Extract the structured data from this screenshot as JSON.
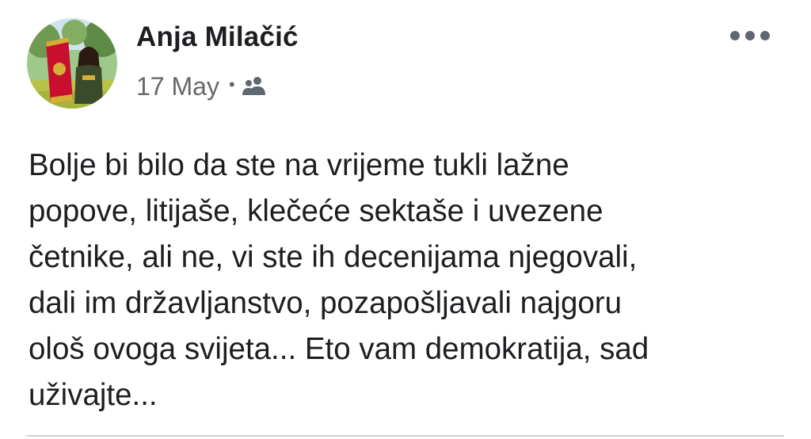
{
  "post": {
    "author": "Anja Milačić",
    "date": "17 May",
    "separator": "•",
    "audience_icon": "friends-icon",
    "more_icon": "more-options-icon",
    "text_lines": [
      "Bolje bi bilo da ste na vrijeme tukli lažne",
      "popove, litijaše, klečeće sektaše i uvezene",
      "četnike, ali ne, vi ste ih decenijama njegovali,",
      "dali im državljanstvo, pozapošljavali najgoru",
      "ološ ovoga svijeta... Eto vam demokratija, sad",
      "uživajte..."
    ]
  },
  "colors": {
    "text": "#1c1e21",
    "secondary_text": "#65676b",
    "icon": "#606770",
    "divider": "#ced0d4",
    "flag_red": "#c8102e",
    "flag_gold": "#d4af37"
  }
}
